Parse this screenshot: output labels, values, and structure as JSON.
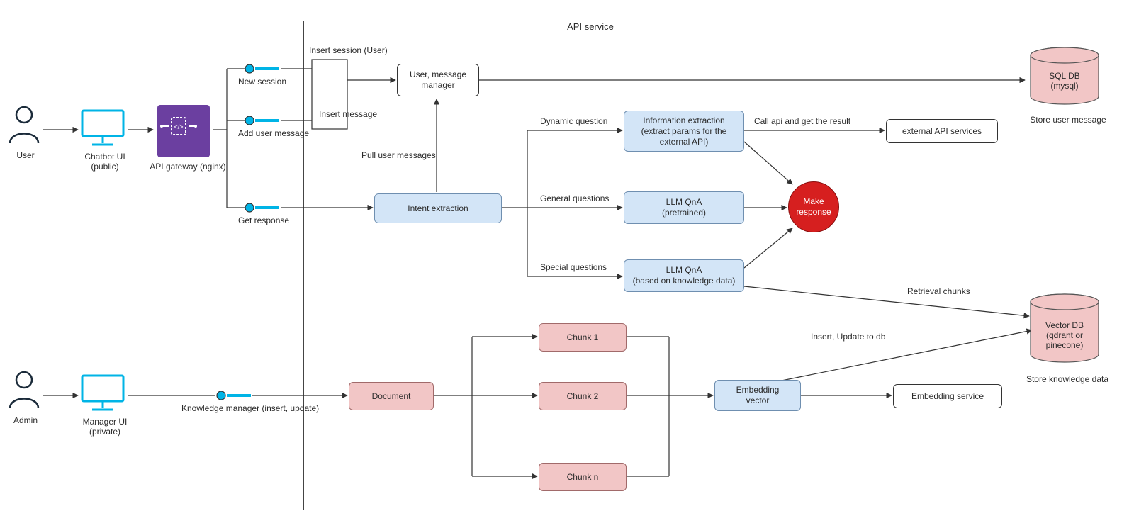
{
  "container": {
    "title": "API service"
  },
  "actors": {
    "user": "User",
    "admin": "Admin",
    "chatbot_ui": "Chatbot UI\n(public)",
    "manager_ui": "Manager UI\n(private)",
    "api_gateway": "API gateway (nginx)"
  },
  "endpoints": {
    "new_session": "New session",
    "add_user_message": "Add user message",
    "get_response": "Get response",
    "knowledge_manager": "Knowledge manager (insert, update)"
  },
  "nodes": {
    "user_msg_mgr": "User, message\nmanager",
    "intent": "Intent extraction",
    "info_extract": "Information extraction\n(extract params for the\nexternal API)",
    "llm_pretrained": "LLM QnA\n(pretrained)",
    "llm_knowledge": "LLM QnA\n(based on knowledge data)",
    "make_response": "Make\nresponse",
    "document": "Document",
    "chunk1": "Chunk 1",
    "chunk2": "Chunk 2",
    "chunkn": "Chunk n",
    "embedding_vector": "Embedding\nvector",
    "external_api": "external API services",
    "embedding_service": "Embedding service"
  },
  "databases": {
    "sql": "SQL DB\n(mysql)",
    "sql_caption": "Store user message",
    "vector": "Vector DB\n(qdrant or\npinecone)",
    "vector_caption": "Store knowledge data"
  },
  "edges": {
    "insert_session": "Insert session (User)",
    "insert_message": "Insert message",
    "pull_user_messages": "Pull user messages",
    "dynamic_question": "Dynamic question",
    "general_questions": "General questions",
    "special_questions": "Special questions",
    "call_api": "Call api and get the result",
    "retrieval_chunks": "Retrieval chunks",
    "insert_update_db": "Insert, Update to db"
  },
  "colors": {
    "blue": "#d3e5f7",
    "red_fill": "#f2c6c6",
    "accent_red": "#d61f1f",
    "cyan": "#00b4e6",
    "purple": "#6b3fa0"
  }
}
